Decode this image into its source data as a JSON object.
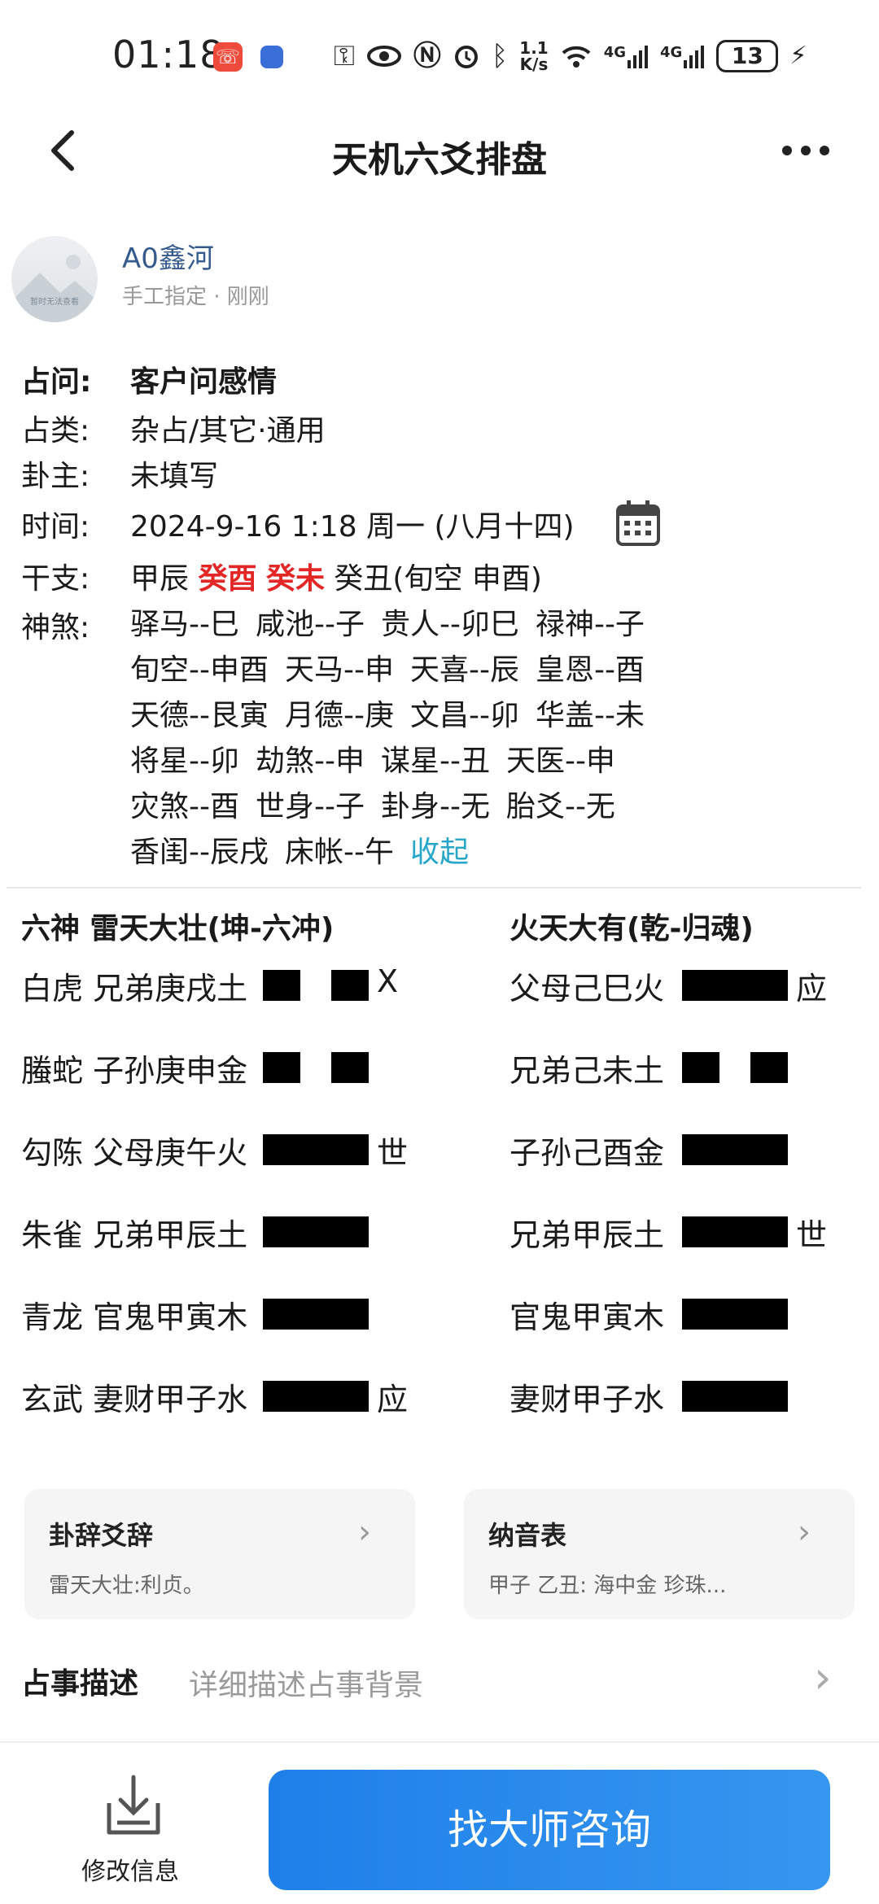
{
  "status": {
    "time": "01:18",
    "speed_top": "1.1",
    "speed_bottom": "K/s",
    "net1": "4G",
    "net2": "4G",
    "battery": "13"
  },
  "header": {
    "title": "天机六爻排盘"
  },
  "user": {
    "name": "A0鑫河",
    "meta": "手工指定 · 刚刚",
    "avatar_text": "暂时无法查看"
  },
  "info": {
    "question_label": "占问:",
    "question": "客户问感情",
    "type_label": "占类:",
    "type": "杂占/其它·通用",
    "owner_label": "卦主:",
    "owner": "未填写",
    "time_label": "时间:",
    "time": "2024-9-16 1:18 周一 (八月十四)",
    "ganzhi_label": "干支:",
    "ganzhi": {
      "year": "甲辰",
      "month": "癸酉",
      "day": "癸未",
      "hour": "癸丑(旬空 申酉)"
    },
    "shensha_label": "神煞:",
    "shensha": [
      [
        "驿马--巳",
        "咸池--子",
        "贵人--卯巳",
        "禄神--子"
      ],
      [
        "旬空--申酉",
        "天马--申",
        "天喜--辰",
        "皇恩--酉"
      ],
      [
        "天德--艮寅",
        "月德--庚",
        "文昌--卯",
        "华盖--未"
      ],
      [
        "将星--卯",
        "劫煞--申",
        "谋星--丑",
        "天医--申"
      ],
      [
        "灾煞--酉",
        "世身--子",
        "卦身--无",
        "胎爻--无"
      ],
      [
        "香闺--辰戌",
        "床帐--午"
      ]
    ],
    "collapse": "收起"
  },
  "hexagram": {
    "left_title": "六神 雷天大壮(坤-六冲)",
    "right_title": "火天大有(乾-归魂)",
    "left_lines": [
      {
        "text": "白虎 兄弟庚戌土",
        "yang": false,
        "mark": "X"
      },
      {
        "text": "螣蛇 子孙庚申金",
        "yang": false,
        "mark": ""
      },
      {
        "text": "勾陈 父母庚午火",
        "yang": true,
        "mark": "世"
      },
      {
        "text": "朱雀 兄弟甲辰土",
        "yang": true,
        "mark": ""
      },
      {
        "text": "青龙 官鬼甲寅木",
        "yang": true,
        "mark": ""
      },
      {
        "text": "玄武 妻财甲子水",
        "yang": true,
        "mark": "应"
      }
    ],
    "right_lines": [
      {
        "text": "父母己巳火",
        "yang": true,
        "mark": "应"
      },
      {
        "text": "兄弟己未土",
        "yang": false,
        "mark": ""
      },
      {
        "text": "子孙己酉金",
        "yang": true,
        "mark": ""
      },
      {
        "text": "兄弟甲辰土",
        "yang": true,
        "mark": "世"
      },
      {
        "text": "官鬼甲寅木",
        "yang": true,
        "mark": ""
      },
      {
        "text": "妻财甲子水",
        "yang": true,
        "mark": ""
      }
    ]
  },
  "cards": [
    {
      "title": "卦辞爻辞",
      "subtitle": "雷天大壮:利贞。"
    },
    {
      "title": "纳音表",
      "subtitle": "甲子 乙丑: 海中金 珍珠..."
    }
  ],
  "description": {
    "label": "占事描述",
    "placeholder": "详细描述占事背景"
  },
  "bottom": {
    "edit_label": "修改信息",
    "cta": "找大师咨询"
  }
}
